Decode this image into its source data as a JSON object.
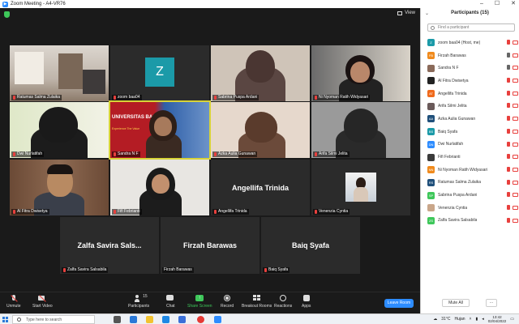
{
  "window": {
    "title": "Zoom Meeting - A4-VR76"
  },
  "meeting": {
    "view_label": "View",
    "tiles": [
      {
        "name": "Ratumas Salma Zulaika"
      },
      {
        "name": "zoom baa04",
        "avatar_letter": "Z"
      },
      {
        "name": "Sabrina Puspa Ardani"
      },
      {
        "name": "Ni Nyoman Ratih Widyasari"
      },
      {
        "name": "Dwi Nurlatifah"
      },
      {
        "name": "Sandra N F",
        "slide_title": "UNIVERSITAS BAKRIE",
        "slide_sub": "Experience The Value"
      },
      {
        "name": "Azka Aulia Gunawan"
      },
      {
        "name": "Arifa Silmi Jelita"
      },
      {
        "name": "Al Fitra Dwisetya"
      },
      {
        "name": "Fifi Febrianti"
      },
      {
        "name": "Angellifa Trinida",
        "big_name": "Angellifa Trinida"
      },
      {
        "name": "Venenzia Cyntia"
      },
      {
        "name": "Zalfa Savira Salsabila",
        "big_name": "Zalfa Savira Sals..."
      },
      {
        "name": "Firzah Barawas",
        "big_name": "Firzah Barawas"
      },
      {
        "name": "Baiq Syafa",
        "big_name": "Baiq Syafa"
      }
    ]
  },
  "toolbar": {
    "unmute": "Unmute",
    "start_video": "Start Video",
    "participants": "Participants",
    "participants_count": "15",
    "chat": "Chat",
    "share_screen": "Share Screen",
    "record": "Record",
    "breakout_rooms": "Breakout Rooms",
    "reactions": "Reactions",
    "apps": "Apps",
    "leave_room": "Leave Room"
  },
  "participants_panel": {
    "title": "Participants (15)",
    "search_placeholder": "Find a participant",
    "mute_all": "Mute All",
    "more": "...",
    "people": [
      {
        "initials": "Z",
        "color": "#1b9aa8",
        "name": "zoom baa04 (Host, me)",
        "mic_on": false
      },
      {
        "initials": "FB",
        "color": "#f08a1c",
        "name": "Firzah Barawas",
        "mic_on": true
      },
      {
        "initials": "",
        "color": "#8a6a5a",
        "name": "Sandra N F",
        "mic_on": true
      },
      {
        "initials": "",
        "color": "#222222",
        "name": "Al Fitra Dwisetya",
        "mic_on": false
      },
      {
        "initials": "AT",
        "color": "#f06a1c",
        "name": "Angellifa Trinida",
        "mic_on": false
      },
      {
        "initials": "",
        "color": "#6a5a5a",
        "name": "Arifa Silmi Jelita",
        "mic_on": false
      },
      {
        "initials": "AA",
        "color": "#1f4f7a",
        "name": "Azka Aulia Gunawan",
        "mic_on": false
      },
      {
        "initials": "BS",
        "color": "#1b9aa8",
        "name": "Baiq Syafa",
        "mic_on": false
      },
      {
        "initials": "DN",
        "color": "#2d8cff",
        "name": "Dwi Nurlatifah",
        "mic_on": false
      },
      {
        "initials": "",
        "color": "#3a3a3a",
        "name": "Fifi Febrianti",
        "mic_on": false
      },
      {
        "initials": "NN",
        "color": "#f08a1c",
        "name": "Ni Nyoman Ratih Widyasari",
        "mic_on": false
      },
      {
        "initials": "RS",
        "color": "#1f4f7a",
        "name": "Ratumas Salma Zulaika",
        "mic_on": false
      },
      {
        "initials": "SP",
        "color": "#3ec75a",
        "name": "Sabrina Puspa Ardani",
        "mic_on": false
      },
      {
        "initials": "",
        "color": "#c9a68a",
        "name": "Venenzia Cyntia",
        "mic_on": false
      },
      {
        "initials": "ZS",
        "color": "#3ec75a",
        "name": "Zalfa Savira Salsabila",
        "mic_on": false
      }
    ]
  },
  "taskbar": {
    "search_placeholder": "Type here to search",
    "weather": "31°C",
    "weather_desc": "Hujan",
    "time": "13:42",
    "date": "02/04/2022"
  },
  "colors": {
    "accent": "#2d8cff",
    "muted_red": "#e8403d",
    "active_speaker": "#d8d338"
  }
}
